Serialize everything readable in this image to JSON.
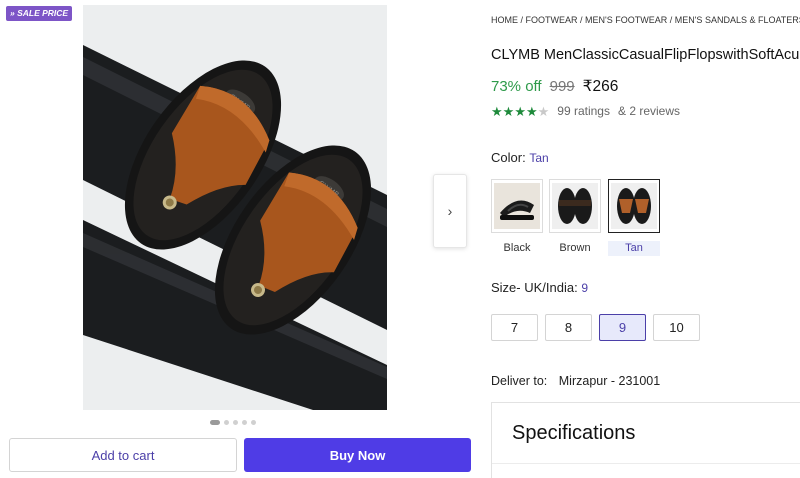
{
  "badge": {
    "text": "» SALE PRICE"
  },
  "gallery": {
    "dot_count": 5,
    "active_index": 0,
    "next_icon": "chevron-right-icon"
  },
  "breadcrumb": "HOME / FOOTWEAR / MEN'S FOOTWEAR / MEN'S SANDALS & FLOATERS / CLYMB",
  "product": {
    "title": "CLYMB MenClassicCasualFlipFlopswithSoftAcupressureFootbed",
    "discount": "73% off",
    "mrp": "999",
    "price": "₹266",
    "rating_stars": 4,
    "ratings_text": "99 ratings",
    "reviews_text": "& 2 reviews"
  },
  "color": {
    "label": "Color:",
    "selected": "Tan",
    "options": [
      "Black",
      "Brown",
      "Tan"
    ]
  },
  "size": {
    "label": "Size- UK/India:",
    "selected": "9",
    "options": [
      "7",
      "8",
      "9",
      "10"
    ]
  },
  "delivery": {
    "label": "Deliver to:",
    "location": "Mirzapur - 231001"
  },
  "specs": {
    "title": "Specifications"
  },
  "actions": {
    "add_to_cart": "Add to cart",
    "buy_now": "Buy Now"
  },
  "colors": {
    "accent": "#4f3ce6",
    "discount": "#2e9a4a",
    "badge": "#7d55c7",
    "star": "#1e8a3b"
  }
}
